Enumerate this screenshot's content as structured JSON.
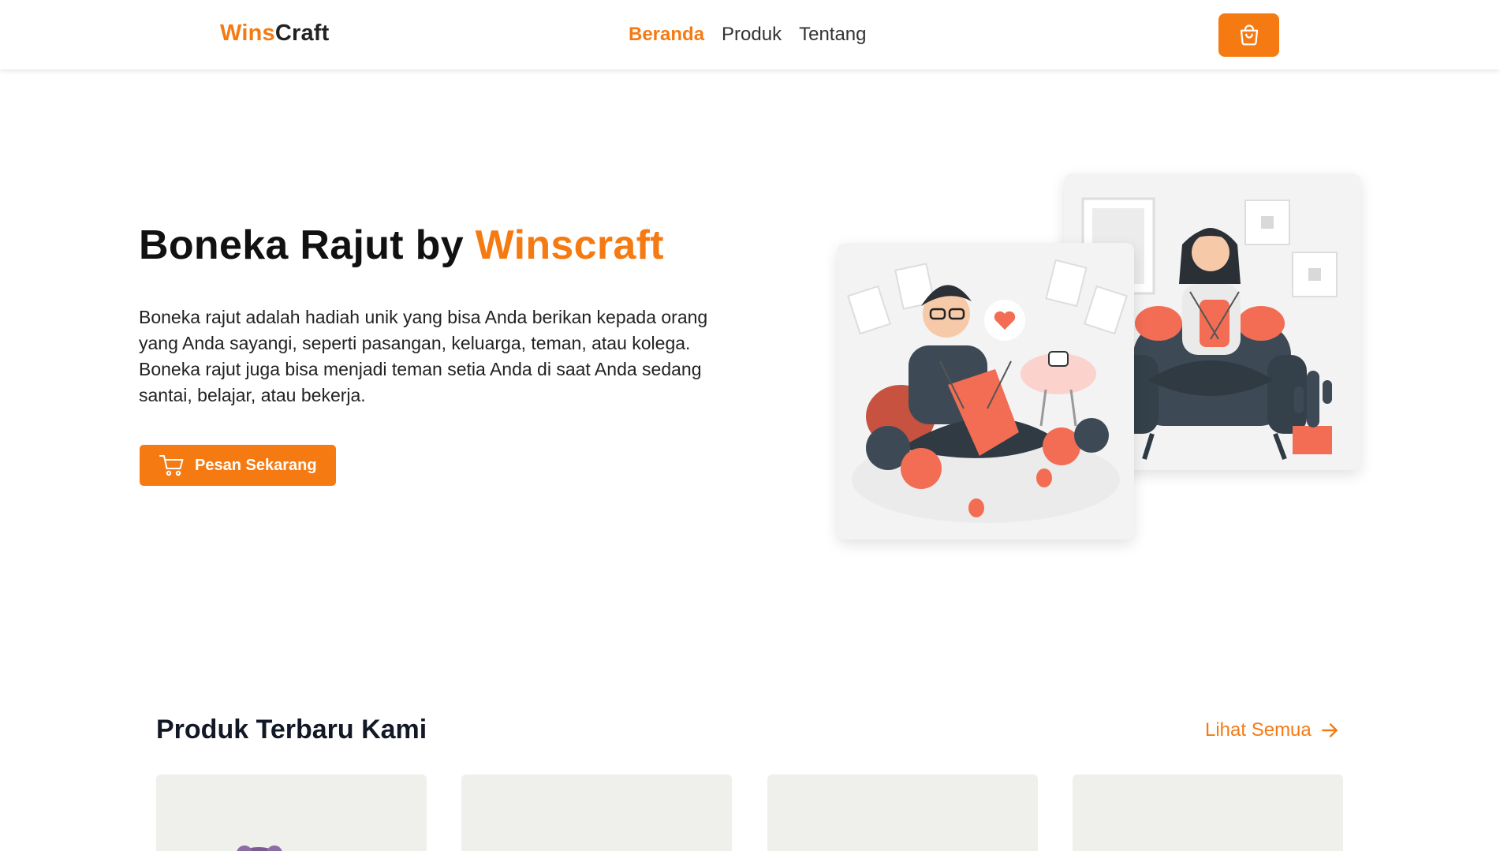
{
  "navbar": {
    "brand_part1": "Wins",
    "brand_part2": "Craft",
    "links": [
      {
        "label": "Beranda",
        "active": true
      },
      {
        "label": "Produk",
        "active": false
      },
      {
        "label": "Tentang",
        "active": false
      }
    ],
    "cart_icon": "shopping-bag-icon"
  },
  "hero": {
    "title_main": "Boneka Rajut by ",
    "title_accent": "Winscraft",
    "description": "Boneka rajut adalah hadiah unik yang bisa Anda berikan kepada orang yang Anda sayangi, seperti pasangan, keluarga, teman, atau kolega. Boneka rajut juga bisa menjadi teman setia Anda di saat Anda sedang santai, belajar, atau bekerja.",
    "cta_label": "Pesan Sekarang",
    "cta_icon": "cart-icon"
  },
  "products": {
    "section_title": "Produk Terbaru Kami",
    "see_all_label": "Lihat Semua",
    "see_all_icon": "arrow-right-icon"
  },
  "colors": {
    "accent": "#f57a12",
    "illustration_coral": "#f26d54",
    "illustration_dark": "#3d4a55"
  }
}
